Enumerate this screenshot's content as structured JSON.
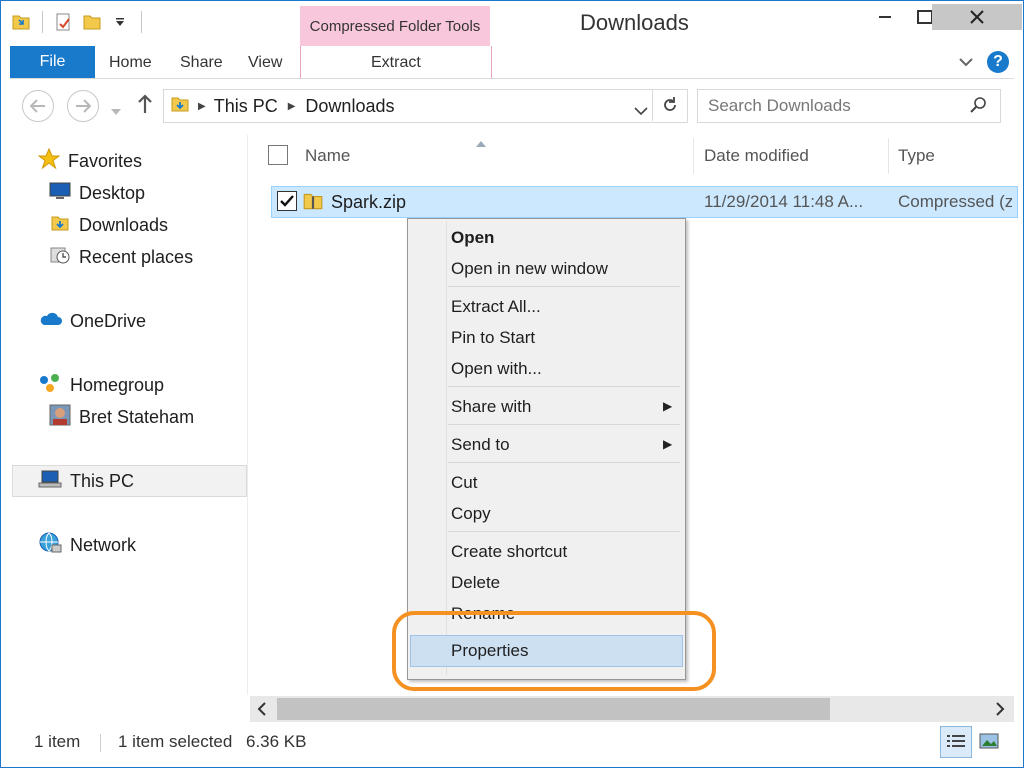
{
  "window": {
    "title": "Downloads"
  },
  "ribbon": {
    "contextual_group": "Compressed Folder Tools",
    "tabs": [
      "File",
      "Home",
      "Share",
      "View",
      "Extract"
    ]
  },
  "address_bar": {
    "breadcrumb": [
      "This PC",
      "Downloads"
    ],
    "search_placeholder": "Search Downloads"
  },
  "navigation_pane": {
    "favorites": {
      "label": "Favorites",
      "items": [
        "Desktop",
        "Downloads",
        "Recent places"
      ]
    },
    "onedrive": "OneDrive",
    "homegroup": {
      "label": "Homegroup",
      "items": [
        "Bret Stateham"
      ]
    },
    "this_pc": "This PC",
    "network": "Network"
  },
  "file_list": {
    "columns": [
      "Name",
      "Date modified",
      "Type"
    ],
    "rows": [
      {
        "name": "Spark.zip",
        "date_modified": "11/29/2014 11:48 A...",
        "type": "Compressed (z",
        "selected": true
      }
    ]
  },
  "context_menu": {
    "items": [
      "Open",
      "Open in new window",
      "Extract All...",
      "Pin to Start",
      "Open with...",
      "Share with",
      "Send to",
      "Cut",
      "Copy",
      "Create shortcut",
      "Delete",
      "Rename",
      "Properties"
    ],
    "highlighted": "Properties",
    "highlight_color": "#f59120"
  },
  "status_bar": {
    "item_count": "1 item",
    "selection": "1 item selected",
    "size": "6.36 KB"
  },
  "colors": {
    "accent": "#1979ca",
    "context_tab": "#f9c7dc",
    "selection": "#cce8ff"
  }
}
